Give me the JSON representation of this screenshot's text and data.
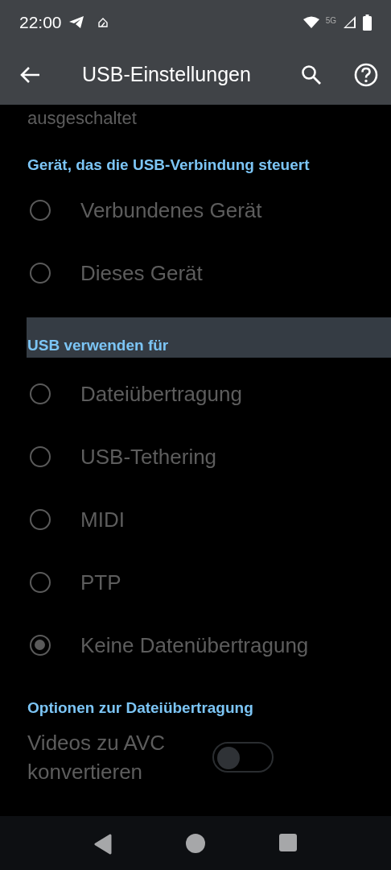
{
  "status_bar": {
    "time": "22:00",
    "network": "5G"
  },
  "app_bar": {
    "title": "USB-Einstellungen"
  },
  "partial_text": "ausgeschaltet",
  "sections": [
    {
      "title": "Gerät, das die USB-Verbindung steuert",
      "highlighted": false,
      "options": [
        {
          "label": "Verbundenes Gerät",
          "selected": false
        },
        {
          "label": "Dieses Gerät",
          "selected": false
        }
      ]
    },
    {
      "title": "USB verwenden für",
      "highlighted": true,
      "options": [
        {
          "label": "Dateiübertragung",
          "selected": false
        },
        {
          "label": "USB-Tethering",
          "selected": false
        },
        {
          "label": "MIDI",
          "selected": false
        },
        {
          "label": "PTP",
          "selected": false
        },
        {
          "label": "Keine Datenübertragung",
          "selected": true
        }
      ]
    },
    {
      "title": "Optionen zur Dateiübertragung",
      "highlighted": false,
      "toggles": [
        {
          "label": "Videos zu AVC konvertieren",
          "on": false
        }
      ]
    }
  ]
}
